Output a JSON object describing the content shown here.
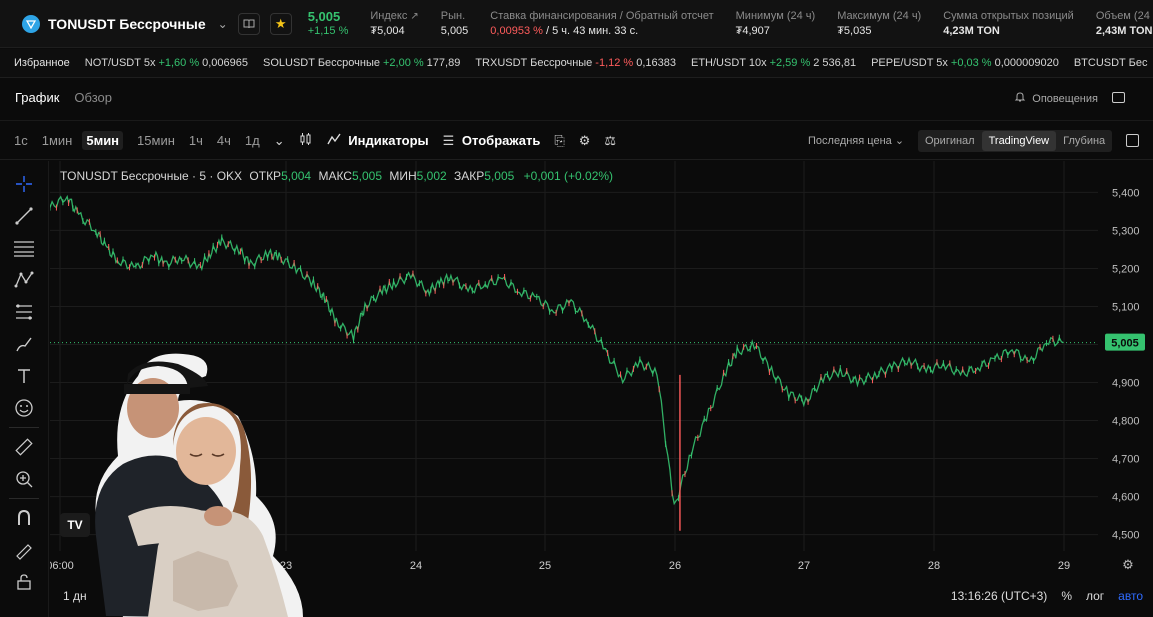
{
  "header": {
    "pair": "TONUSDT Бессрочные",
    "price": "5,005",
    "change": "+1,15 %",
    "stats": [
      {
        "label": "Индекс",
        "value": "₮5,004",
        "has_link": true
      },
      {
        "label": "Рын.",
        "value": "5,005"
      },
      {
        "label": "Ставка финансирования / Обратный отсчет",
        "value_red": "0,00953 %",
        "value_rest": "/ 5 ч. 43 мин. 33 с."
      },
      {
        "label": "Минимум (24 ч)",
        "value": "₮4,907"
      },
      {
        "label": "Максимум (24 ч)",
        "value": "₮5,035"
      },
      {
        "label": "Сумма открытых позиций",
        "value": "4,23M TON"
      },
      {
        "label": "Объем (24",
        "value": "2,43M TON"
      }
    ]
  },
  "favorites": {
    "label": "Избранное",
    "items": [
      {
        "name": "NOT/USDT 5x",
        "change": "+1,60 %",
        "dir": "up",
        "price": "0,006965"
      },
      {
        "name": "SOLUSDT Бессрочные",
        "change": "+2,00 %",
        "dir": "up",
        "price": "177,89"
      },
      {
        "name": "TRXUSDT Бессрочные",
        "change": "-1,12 %",
        "dir": "down",
        "price": "0,16383"
      },
      {
        "name": "ETH/USDT 10x",
        "change": "+2,59 %",
        "dir": "up",
        "price": "2 536,81"
      },
      {
        "name": "PEPE/USDT 5x",
        "change": "+0,03 %",
        "dir": "up",
        "price": "0,000009020"
      },
      {
        "name": "BTCUSDT Бес",
        "change": "",
        "dir": "up",
        "price": ""
      }
    ]
  },
  "tabs": {
    "chart": "График",
    "overview": "Обзор",
    "alerts": "Оповещения"
  },
  "toolbar": {
    "timeframes": [
      "1с",
      "1мин",
      "5мин",
      "15мин",
      "1ч",
      "4ч",
      "1д"
    ],
    "active_timeframe": "5мин",
    "indicators": "Индикаторы",
    "display": "Отображать",
    "last_price": "Последняя цена",
    "views": [
      "Оригинал",
      "TradingView",
      "Глубина"
    ],
    "active_view": "TradingView"
  },
  "legend": {
    "title": "TONUSDT Бессрочные · 5 · OKX",
    "open_label": "ОТКР",
    "open": "5,004",
    "high_label": "МАКС",
    "high": "5,005",
    "low_label": "МИН",
    "low": "5,002",
    "close_label": "ЗАКР",
    "close": "5,005",
    "change": "+0,001 (+0.02%)"
  },
  "chart_data": {
    "type": "line",
    "title": "TONUSDT Бессрочные · 5 · OKX",
    "x_ticks": [
      "06:00",
      "23",
      "24",
      "25",
      "26",
      "27",
      "28",
      "29"
    ],
    "y_ticks": [
      "5,400",
      "5,300",
      "5,200",
      "5,100",
      "5,000",
      "4,900",
      "4,800",
      "4,700",
      "4,600",
      "4,500"
    ],
    "ylim": [
      4.47,
      5.43
    ],
    "last_price": "5,005",
    "series": [
      {
        "x": [
          0,
          0.3,
          0.5,
          0.8,
          1.0,
          1.2,
          1.5,
          1.8,
          2.0,
          2.3,
          2.6,
          2.8,
          3.0,
          3.3,
          3.5,
          3.8,
          4.0,
          4.3,
          4.6,
          4.8,
          5.0,
          5.3,
          5.5,
          5.8,
          6.0,
          6.3,
          6.6,
          6.8,
          7.0,
          7.3,
          7.6,
          7.9,
          8.2,
          8.5,
          8.8,
          9.1,
          9.4,
          9.7,
          10.0,
          10.3,
          10.6,
          10.9,
          11.2,
          11.5,
          11.8,
          12.0,
          12.3,
          12.6,
          12.9,
          13.2,
          13.5,
          13.8,
          14.1,
          14.4,
          14.7,
          15.0,
          15.3,
          15.6,
          15.9,
          16.2,
          16.5,
          16.8,
          17.1,
          17.4,
          17.7
        ],
        "values": [
          5.36,
          5.39,
          5.34,
          5.3,
          5.25,
          5.22,
          5.2,
          5.24,
          5.21,
          5.23,
          5.2,
          5.24,
          5.27,
          5.25,
          5.21,
          5.24,
          5.23,
          5.2,
          5.16,
          5.12,
          5.06,
          5.02,
          5.1,
          5.14,
          5.16,
          5.18,
          5.14,
          5.16,
          5.18,
          5.14,
          5.16,
          5.17,
          5.14,
          5.12,
          5.09,
          5.11,
          5.06,
          4.98,
          4.91,
          4.95,
          4.93,
          4.57,
          4.72,
          4.82,
          4.93,
          4.98,
          5.0,
          4.93,
          4.87,
          4.85,
          4.91,
          4.93,
          4.9,
          4.92,
          4.94,
          4.96,
          4.93,
          4.95,
          4.92,
          4.94,
          4.96,
          4.99,
          4.95,
          5.01,
          5.005
        ]
      }
    ]
  },
  "bottombar": {
    "range": "1 дн",
    "time": "13:16:26 (UTC+3)",
    "percent": "%",
    "log": "лог",
    "auto": "авто"
  },
  "logo_text": "TV",
  "colors": {
    "up": "#35c26f",
    "down": "#ff5c5c",
    "accent": "#2f6bff",
    "background": "#0b0b0b"
  }
}
